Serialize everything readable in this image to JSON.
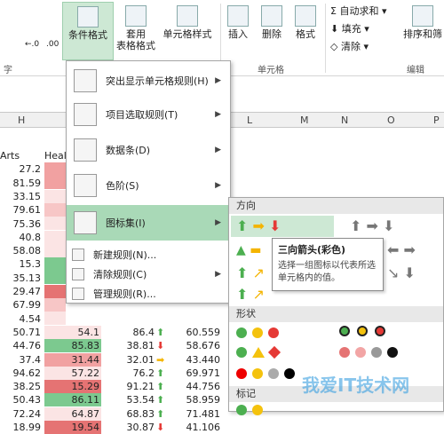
{
  "ribbon": {
    "buttons": {
      "conditional": "条件格式",
      "table_fmt_1": "套用",
      "table_fmt_2": "表格格式",
      "cell_style": "单元格样式",
      "insert": "插入",
      "delete": "删除",
      "format": "格式",
      "autosum": "自动求和",
      "fill": "填充",
      "clear": "清除",
      "sort": "排序和筛"
    },
    "groups": {
      "font": "字",
      "cells": "单元格",
      "edit": "编辑"
    },
    "dec": {
      "a": "←.0",
      "b": ".00"
    }
  },
  "sheet": {
    "col_headers": [
      "H",
      "L",
      "M",
      "N",
      "O",
      "P"
    ],
    "col_h_values": [
      "Arts",
      "27.2",
      "81.59",
      "33.15",
      "79.61",
      "75.36",
      "40.8",
      "58.08",
      "15.3",
      "35.13",
      "29.47",
      "67.99",
      "4.54",
      "50.71",
      "44.76",
      "37.4",
      "94.62",
      "38.25",
      "50.43",
      "72.24",
      "18.99"
    ],
    "col_i_header": "Heal",
    "rows_bottom": [
      {
        "i": "54.1",
        "j": "86.4",
        "k": "60.559"
      },
      {
        "i": "85.83",
        "j": "38.81",
        "k": "58.676"
      },
      {
        "i": "31.44",
        "j": "32.01",
        "k": "43.440"
      },
      {
        "i": "57.22",
        "j": "76.2",
        "k": "69.971"
      },
      {
        "i": "15.29",
        "j": "91.21",
        "k": "44.756"
      },
      {
        "i": "86.11",
        "j": "53.54",
        "k": "58.959"
      },
      {
        "i": "64.87",
        "j": "68.83",
        "k": "71.481"
      },
      {
        "i": "19.54",
        "j": "30.87",
        "k": "41.106"
      }
    ]
  },
  "menu": {
    "items": [
      "突出显示单元格规则(H)",
      "项目选取规则(T)",
      "数据条(D)",
      "色阶(S)",
      "图标集(I)",
      "新建规则(N)...",
      "清除规则(C)",
      "管理规则(R)..."
    ]
  },
  "submenu": {
    "direction": "方向",
    "shape": "形状",
    "mark": "标记"
  },
  "tooltip": {
    "title": "三向箭头(彩色)",
    "desc": "选择一组图标以代表所选单元格内的值。"
  },
  "watermark": "我爱IT技术网",
  "colors": {
    "green": "#4caf50",
    "yellow": "#f4c20d",
    "red": "#e53935",
    "highlight": "#a9d9b7"
  }
}
